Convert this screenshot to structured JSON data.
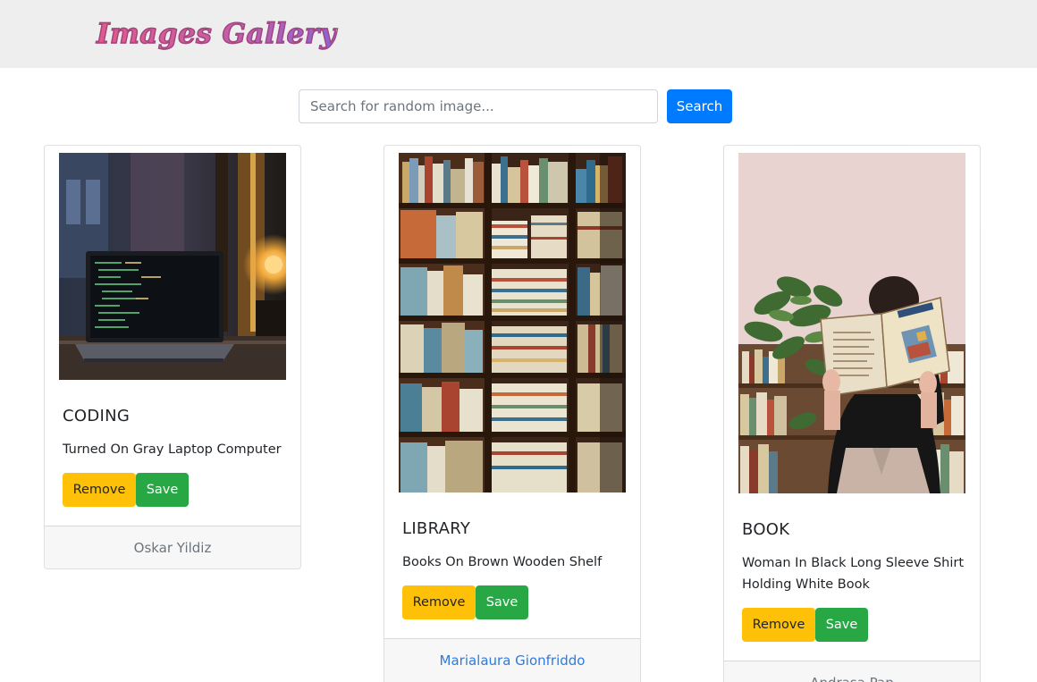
{
  "navbar": {
    "brand": "Images Gallery"
  },
  "search": {
    "placeholder": "Search for random image...",
    "button_label": "Search"
  },
  "cards": [
    {
      "title": "CODING",
      "description": "Turned On Gray Laptop Computer",
      "remove_label": "Remove",
      "save_label": "Save",
      "author": "Oskar Yildiz",
      "author_linked": false
    },
    {
      "title": "LIBRARY",
      "description": "Books On Brown Wooden Shelf",
      "remove_label": "Remove",
      "save_label": "Save",
      "author": "Marialaura Gionfriddo",
      "author_linked": true
    },
    {
      "title": "BOOK",
      "description": "Woman In Black Long Sleeve Shirt Holding White Book",
      "remove_label": "Remove",
      "save_label": "Save",
      "author": "Andrasa Pap",
      "author_linked": false
    }
  ],
  "colors": {
    "primary": "#007bff",
    "warning": "#ffc107",
    "success": "#28a745",
    "link": "#2d7be0",
    "navbar_bg": "#eeeeef"
  }
}
